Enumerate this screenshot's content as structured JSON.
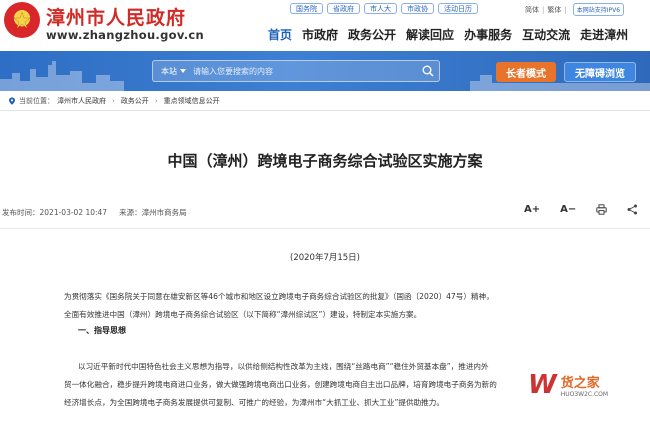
{
  "header": {
    "site_title": "漳州市人民政府",
    "site_domain": "www.zhangzhou.gov.cn",
    "top_links": [
      "国务院",
      "省政府",
      "市人大",
      "市政协",
      "活动日历"
    ],
    "lang": {
      "simplified": "简体",
      "traditional": "繁体",
      "ipv6": "本网站支持IPV6"
    },
    "nav": [
      "首页",
      "市政府",
      "政务公开",
      "解读回应",
      "办事服务",
      "互动交流",
      "走进漳州"
    ],
    "nav_active": "首页"
  },
  "banner": {
    "search_scope": "本站",
    "search_placeholder": "请输入您要搜索的内容",
    "elder_mode": "长者模式",
    "accessible_mode": "无障碍浏览"
  },
  "breadcrumb": {
    "prefix": "当前位置：",
    "items": [
      "漳州市人民政府",
      "政务公开",
      "重点领域信息公开"
    ]
  },
  "article": {
    "title": "中国（漳州）跨境电子商务综合试验区实施方案",
    "published": "发布时间：2021-03-02 10:47",
    "source": "来源：漳州市商务局",
    "font_larger": "A+",
    "font_smaller": "A−",
    "date_line": "(2020年7月15日)",
    "para1_line1": "为贯彻落实《国务院关于同意在雄安新区等46个城市和地区设立跨境电子商务综合试验区的批复》（国函〔2020〕47号）精神，",
    "para1_line2": "全面有效推进中国（漳州）跨境电子商务综合试验区（以下简称“漳州综试区”）建设，特制定本实施方案。",
    "section1": "一、指导思想",
    "para2_line1": "以习近平新时代中国特色社会主义思想为指导，以供给侧结构性改革为主线，围绕“丝路电商”“稳住外贸基本盘”，推进内外",
    "para2_line2": "贸一体化融合，稳步提升跨境电商进口业务，做大做强跨境电商出口业务，创建跨境电商自主出口品牌，培育跨境电子商务为新的",
    "para2_line3": "经济增长点，为全国跨境电子商务发展提供可复制、可推广的经验，为漳州市“大抓工业、抓大工业”提供助推力。"
  },
  "watermark": {
    "logo": "W",
    "text": "货之家",
    "url": "HUO3W2C.COM"
  }
}
